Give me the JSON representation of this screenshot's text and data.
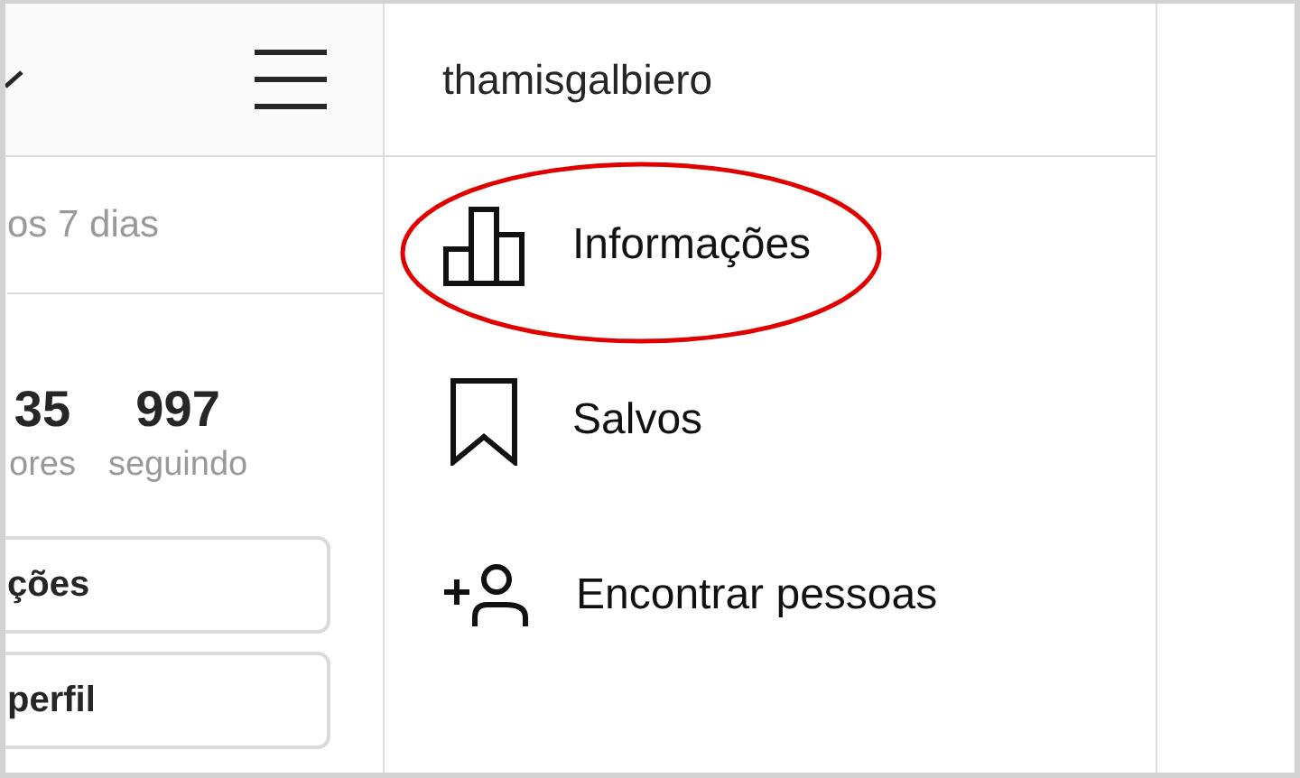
{
  "profile_panel": {
    "period_text": "os 7 dias",
    "stats": [
      {
        "value": "35",
        "label": "ores"
      },
      {
        "value": "997",
        "label": "seguindo"
      }
    ],
    "buttons": [
      "ções",
      "perfil"
    ]
  },
  "menu": {
    "username": "thamisgalbiero",
    "items": [
      {
        "kind": "insights",
        "label": "Informações",
        "circled": true
      },
      {
        "kind": "saved",
        "label": "Salvos",
        "circled": false
      },
      {
        "kind": "discover",
        "label": "Encontrar pessoas",
        "circled": false
      }
    ]
  }
}
